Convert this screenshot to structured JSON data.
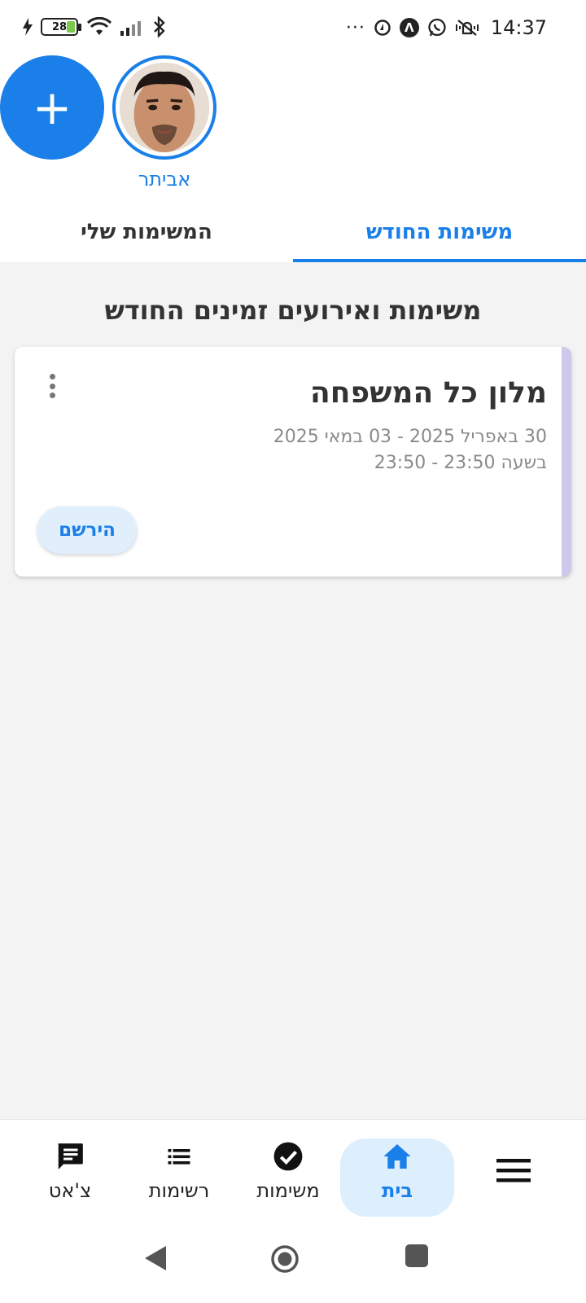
{
  "status_bar": {
    "time": "14:37",
    "battery": "28",
    "more": "···"
  },
  "stories": {
    "add_symbol": "+",
    "user_name": "אביתר"
  },
  "tabs": [
    {
      "label": "משימות החודש",
      "active": true
    },
    {
      "label": "המשימות שלי",
      "active": false
    }
  ],
  "main": {
    "section_title": "משימות ואירועים זמינים החודש",
    "card": {
      "title": "מלון כל המשפחה",
      "date_range": "30 באפריל 2025 - 03 במאי 2025",
      "time_range": "בשעה 23:50 - 23:50",
      "register_label": "הירשם"
    }
  },
  "bottom_nav": {
    "home": {
      "label": "בית",
      "icon": "home-icon",
      "active": true
    },
    "tasks": {
      "label": "משימות",
      "icon": "check-circle-icon"
    },
    "lists": {
      "label": "רשימות",
      "icon": "list-icon"
    },
    "chat": {
      "label": "צ'אט",
      "icon": "chat-icon"
    },
    "menu_icon": "hamburger-icon"
  },
  "colors": {
    "accent": "#1a7fe8",
    "background": "#f3f3f3",
    "card_stripe": "#cfc8ea",
    "active_nav_bg": "#ddeefd"
  }
}
